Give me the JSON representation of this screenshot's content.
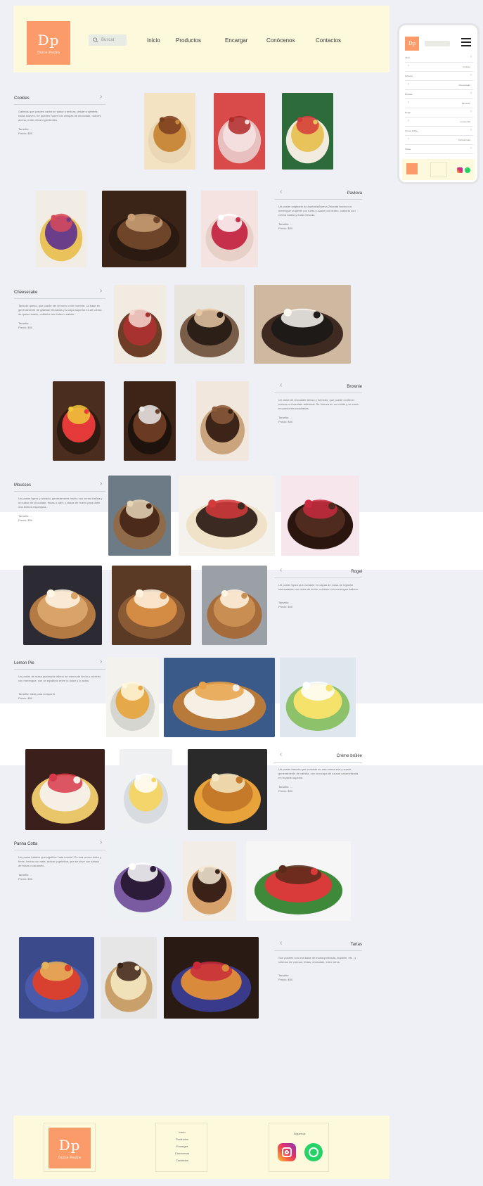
{
  "brand": {
    "monogram": "Dp",
    "tagline": "Dulce Postre",
    "color": "#fb9b6a"
  },
  "search": {
    "placeholder": "Buscar"
  },
  "nav": [
    {
      "label": "Inicio"
    },
    {
      "label": "Productos"
    },
    {
      "label": "Encargar"
    },
    {
      "label": "Conócenos"
    },
    {
      "label": "Contactos"
    }
  ],
  "categories": [
    {
      "title": "Cookies",
      "description": "Galletas que pueden variar en sabor y textura, desde crujientes hasta suaves. Se pueden hacer con chispas de chocolate, nueces, avena, entre otros ingredientes.",
      "size": "Tamaño: ...",
      "price": "Precio: $00"
    },
    {
      "title": "Pavlova",
      "description": "Un postre originario de Australia/Nueva Zelanda hecho con merengue crujiente por fuera y suave por dentro, cubierto con crema batida y frutas frescas.",
      "size": "Tamaño: ...",
      "price": "Precio: $00"
    },
    {
      "title": "Cheesecake",
      "description": "Tarta de queso, que puede ser al horno o sin hornear. La base es generalmente de galletas trituradas y la capa superior es de crema de queso suave, cubierta con frutas o salsas.",
      "size": "Tamaño: ...",
      "price": "Precio: $00"
    },
    {
      "title": "Brownie",
      "description": "Un dulce de chocolate denso y húmedo, que puede contener nueces o chocolate adicional. Se hornea en un molde y se corta en porciones cuadradas.",
      "size": "Tamaño: ...",
      "price": "Precio: $00"
    },
    {
      "title": "Mousses",
      "description": "Un postre ligero y aireado, generalmente hecho con crema batida y un sabor de chocolate, frutas o café, y claras de huevo para darle una textura esponjosa.",
      "size": "Tamaño: ...",
      "price": "Precio: $00"
    },
    {
      "title": "Rogel",
      "description": "Un postre típico que consiste en capas de masa de hojaldre intercaladas con dulce de leche, cubierto con merengue italiano.",
      "size": "Tamaño: ...",
      "price": "Precio: $00"
    },
    {
      "title": "Lemon Pie",
      "description": "Un postre de masa quebrada relleno de crema de limón y cubierto con merengue, con un equilibrio entre lo dulce y lo ácido.",
      "size": "Tamaño: Ideal para compartir",
      "price": "Precio: $00"
    },
    {
      "title": "Crème brûlée",
      "description": "Un postre francés que consiste en una crema rica y suave, generalmente de vainilla, con una capa de azúcar caramelizada en la parte superior.",
      "size": "Tamaño: ...",
      "price": "Precio: $00"
    },
    {
      "title": "Panna Cotta",
      "description": "Un postre italiano que significa 'nata cocida'. Es una crema dulce y firme, hecha con nata, azúcar y gelatina, que se sirve con salsas de frutas o caramelo.",
      "size": "Tamaño: ...",
      "price": "Precio: $00"
    },
    {
      "title": "Tartas",
      "description": "Son postres con una base de masa quebrada, hojaldre, etc., y rellenos de cremas, frutas, chocolate, entre otros.",
      "size": "Tamaño: ...",
      "price": "Precio: $00"
    }
  ],
  "mobile": {
    "items": [
      "Inicio",
      "Cookies",
      "Pavlova",
      "Cheesecake",
      "Brownie",
      "Mousses",
      "Rogel",
      "Lemon Pie",
      "Crème brûlée",
      "Panna Cotta",
      "Tartas"
    ]
  },
  "footer": {
    "links": [
      "Inicio",
      "Productos",
      "Encargar",
      "Conócenos",
      "Contactos"
    ],
    "social_title": "Síguenos",
    "social": [
      "instagram-icon",
      "whatsapp-icon"
    ]
  }
}
